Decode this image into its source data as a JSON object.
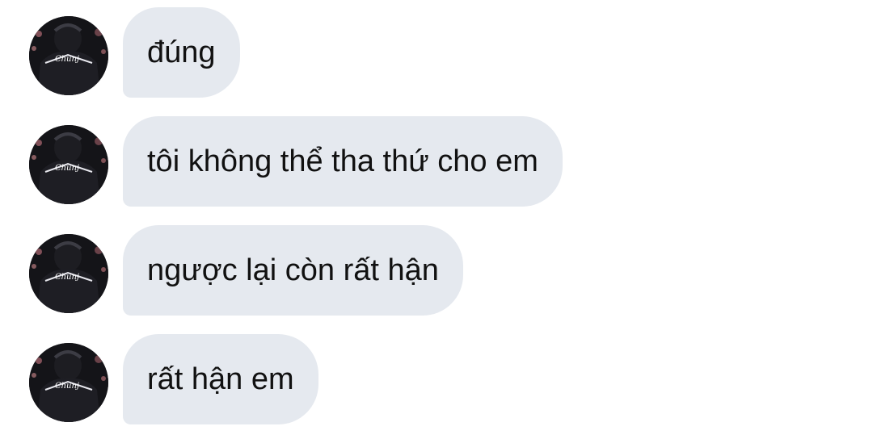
{
  "messages": [
    {
      "text": "đúng",
      "avatar_icon": "user-avatar-icon"
    },
    {
      "text": "tôi không thể tha thứ cho em",
      "avatar_icon": "user-avatar-icon"
    },
    {
      "text": "ngược lại còn rất hận",
      "avatar_icon": "user-avatar-icon"
    },
    {
      "text": "rất hận em",
      "avatar_icon": "user-avatar-icon"
    }
  ],
  "avatar": {
    "label": "Chunj"
  },
  "colors": {
    "bubble_background": "#e5e9ef",
    "text": "#111111",
    "page_background": "#ffffff"
  }
}
